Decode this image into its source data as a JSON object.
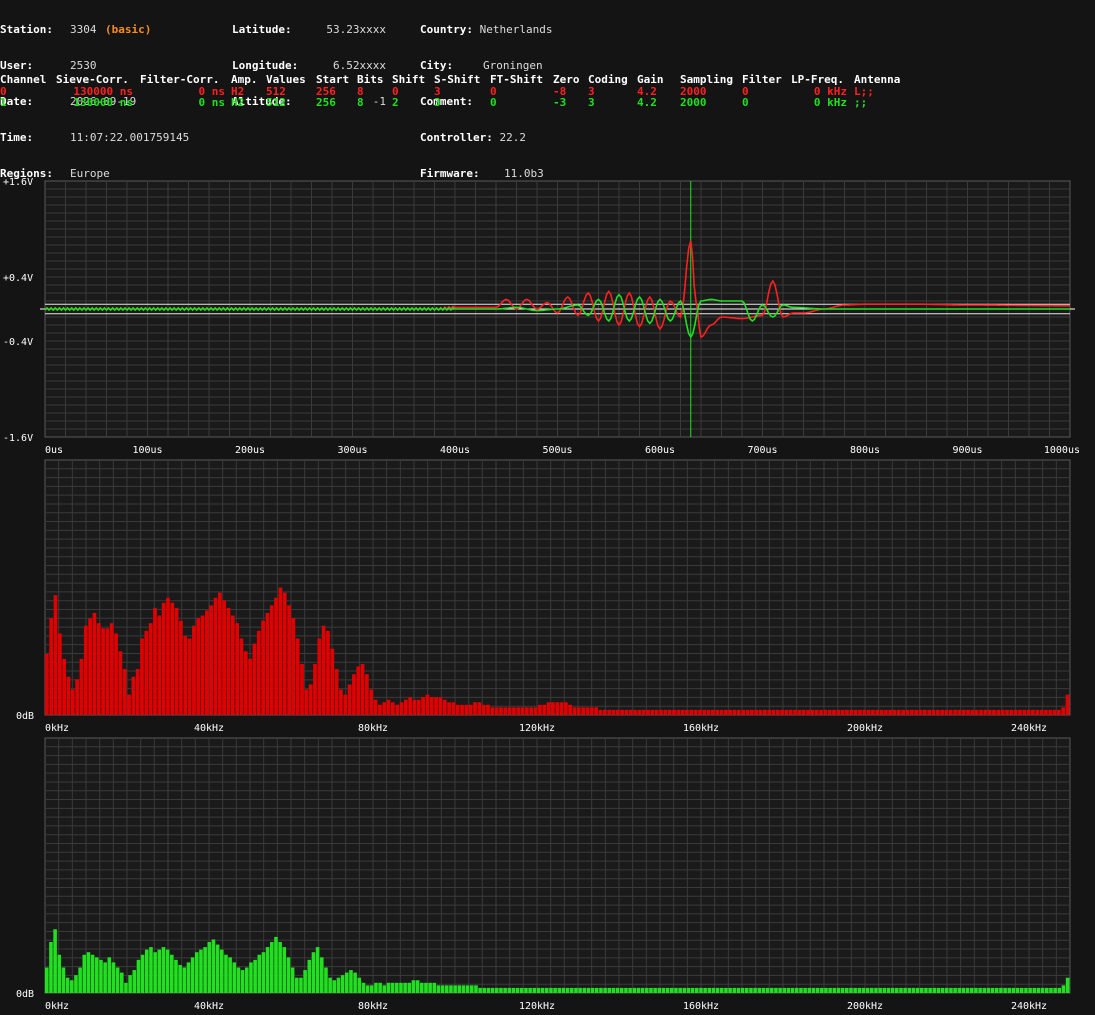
{
  "header": {
    "col1": [
      {
        "label": "Station:",
        "value": "3304",
        "extra": "(basic)"
      },
      {
        "label": "User:",
        "value": "2530"
      },
      {
        "label": "Date:",
        "value": "2026-09-19"
      },
      {
        "label": "Time:",
        "value": "11:07:22.001759145"
      },
      {
        "label": "Regions:",
        "value": "Europe"
      }
    ],
    "col2": [
      {
        "label": "Latitude:",
        "value": "53.23xxxx"
      },
      {
        "label": "Longitude:",
        "value": "6.52xxxx"
      },
      {
        "label": "Altitude:",
        "value": "-1"
      }
    ],
    "col3": [
      {
        "label": "Country:",
        "value": "Netherlands"
      },
      {
        "label": "City:",
        "value": "Groningen"
      },
      {
        "label": "Comment:",
        "value": ""
      },
      {
        "label": "Controller:",
        "value": "22.2"
      },
      {
        "label": "Firmware:",
        "value": "11.0b3"
      }
    ]
  },
  "channels": {
    "headers": [
      "Channel",
      "Sieve-Corr.",
      "Filter-Corr.",
      "Amp.",
      "Values",
      "Start",
      "Bits",
      "Shift",
      "S-Shift",
      "FT-Shift",
      "Zero",
      "Coding",
      "Gain",
      "Sampling",
      "Filter",
      "LP-Freq.",
      "Antenna"
    ],
    "rows": [
      {
        "color": "#ff2020",
        "cells": [
          "0",
          "130000 ns",
          "0 ns",
          "H2",
          "512",
          "256",
          "8",
          "0",
          "3",
          "0",
          "-8",
          "3",
          "4.2",
          "2000",
          "0",
          "0 kHz",
          "L;;"
        ]
      },
      {
        "color": "#20e020",
        "cells": [
          "1",
          "130000 ns",
          "0 ns",
          "H2",
          "512",
          "256",
          "8",
          "2",
          "3",
          "0",
          "-3",
          "3",
          "4.2",
          "2000",
          "0",
          "0 kHz",
          ";;"
        ]
      }
    ]
  },
  "chart_data": [
    {
      "type": "line",
      "xlabel": "",
      "ylabel": "",
      "x_ticks": [
        "0us",
        "100us",
        "200us",
        "300us",
        "400us",
        "500us",
        "600us",
        "700us",
        "800us",
        "900us",
        "1000us"
      ],
      "y_ticks": [
        "+1.6V",
        "+0.4V",
        "-0.4V",
        "-1.6V"
      ],
      "xlim": [
        0,
        1000
      ],
      "ylim": [
        -1.6,
        1.6
      ],
      "trigger_x": 630,
      "series": [
        {
          "color": "#ff2020",
          "points": [
            [
              0,
              0.0
            ],
            [
              380,
              0.0
            ],
            [
              400,
              0.02
            ],
            [
              440,
              0.02
            ],
            [
              450,
              0.12
            ],
            [
              460,
              0.0
            ],
            [
              470,
              0.12
            ],
            [
              480,
              0.0
            ],
            [
              490,
              0.08
            ],
            [
              500,
              -0.05
            ],
            [
              510,
              0.15
            ],
            [
              520,
              -0.08
            ],
            [
              530,
              0.2
            ],
            [
              540,
              -0.15
            ],
            [
              550,
              0.22
            ],
            [
              560,
              -0.2
            ],
            [
              570,
              0.2
            ],
            [
              580,
              -0.22
            ],
            [
              590,
              0.15
            ],
            [
              600,
              -0.25
            ],
            [
              610,
              0.1
            ],
            [
              620,
              -0.1
            ],
            [
              630,
              0.85
            ],
            [
              635,
              0.1
            ],
            [
              640,
              -0.35
            ],
            [
              650,
              -0.2
            ],
            [
              660,
              -0.1
            ],
            [
              680,
              -0.12
            ],
            [
              700,
              -0.08
            ],
            [
              710,
              0.35
            ],
            [
              720,
              -0.1
            ],
            [
              730,
              -0.05
            ],
            [
              740,
              -0.05
            ],
            [
              760,
              0.0
            ],
            [
              780,
              0.05
            ],
            [
              800,
              0.06
            ],
            [
              850,
              0.06
            ],
            [
              900,
              0.05
            ],
            [
              1000,
              0.04
            ]
          ]
        },
        {
          "color": "#20e020",
          "points": [
            [
              0,
              0.0
            ],
            [
              400,
              0.0
            ],
            [
              440,
              0.0
            ],
            [
              460,
              0.02
            ],
            [
              480,
              -0.02
            ],
            [
              500,
              0.0
            ],
            [
              520,
              0.05
            ],
            [
              530,
              -0.08
            ],
            [
              540,
              0.12
            ],
            [
              550,
              -0.15
            ],
            [
              560,
              0.18
            ],
            [
              570,
              -0.15
            ],
            [
              580,
              0.15
            ],
            [
              590,
              -0.18
            ],
            [
              600,
              0.12
            ],
            [
              610,
              -0.15
            ],
            [
              620,
              0.1
            ],
            [
              630,
              -0.35
            ],
            [
              640,
              0.1
            ],
            [
              650,
              0.12
            ],
            [
              660,
              0.1
            ],
            [
              680,
              0.1
            ],
            [
              690,
              -0.15
            ],
            [
              700,
              0.05
            ],
            [
              710,
              -0.1
            ],
            [
              720,
              0.05
            ],
            [
              730,
              0.02
            ],
            [
              760,
              0.0
            ],
            [
              1000,
              0.0
            ]
          ]
        }
      ]
    },
    {
      "type": "bar",
      "color": "#e00000",
      "x_ticks": [
        "0kHz",
        "40kHz",
        "80kHz",
        "120kHz",
        "160kHz",
        "200kHz",
        "240kHz"
      ],
      "y_ticks": [
        "0dB"
      ],
      "values": [
        0.24,
        0.38,
        0.47,
        0.32,
        0.22,
        0.15,
        0.1,
        0.14,
        0.22,
        0.35,
        0.38,
        0.4,
        0.36,
        0.34,
        0.34,
        0.36,
        0.32,
        0.25,
        0.18,
        0.08,
        0.15,
        0.18,
        0.3,
        0.33,
        0.36,
        0.42,
        0.39,
        0.44,
        0.46,
        0.44,
        0.42,
        0.37,
        0.31,
        0.3,
        0.35,
        0.38,
        0.39,
        0.41,
        0.43,
        0.46,
        0.48,
        0.45,
        0.42,
        0.39,
        0.36,
        0.3,
        0.25,
        0.22,
        0.28,
        0.33,
        0.37,
        0.4,
        0.43,
        0.46,
        0.5,
        0.48,
        0.43,
        0.38,
        0.3,
        0.2,
        0.1,
        0.12,
        0.2,
        0.3,
        0.35,
        0.33,
        0.26,
        0.18,
        0.1,
        0.08,
        0.12,
        0.16,
        0.19,
        0.2,
        0.16,
        0.1,
        0.06,
        0.04,
        0.05,
        0.06,
        0.05,
        0.04,
        0.05,
        0.06,
        0.07,
        0.06,
        0.06,
        0.07,
        0.08,
        0.07,
        0.07,
        0.07,
        0.06,
        0.05,
        0.05,
        0.04,
        0.04,
        0.04,
        0.04,
        0.05,
        0.05,
        0.04,
        0.04,
        0.03,
        0.03,
        0.03,
        0.03,
        0.03,
        0.03,
        0.03,
        0.03,
        0.03,
        0.03,
        0.03,
        0.04,
        0.04,
        0.05,
        0.05,
        0.05,
        0.05,
        0.05,
        0.04,
        0.03,
        0.03,
        0.03,
        0.03,
        0.03,
        0.03,
        0.02,
        0.02,
        0.02,
        0.02,
        0.02,
        0.02,
        0.02,
        0.02,
        0.02,
        0.02,
        0.02,
        0.02,
        0.02,
        0.02,
        0.02,
        0.02,
        0.02,
        0.02,
        0.02,
        0.02,
        0.02,
        0.02,
        0.02,
        0.02,
        0.02,
        0.02,
        0.02,
        0.02,
        0.02,
        0.02,
        0.02,
        0.02,
        0.02,
        0.02,
        0.02,
        0.02,
        0.02,
        0.02,
        0.02,
        0.02,
        0.02,
        0.02,
        0.02,
        0.02,
        0.02,
        0.02,
        0.02,
        0.02,
        0.02,
        0.02,
        0.02,
        0.02,
        0.02,
        0.02,
        0.02,
        0.02,
        0.02,
        0.02,
        0.02,
        0.02,
        0.02,
        0.02,
        0.02,
        0.02,
        0.02,
        0.02,
        0.02,
        0.02,
        0.02,
        0.02,
        0.02,
        0.02,
        0.02,
        0.02,
        0.02,
        0.02,
        0.02,
        0.02,
        0.02,
        0.02,
        0.02,
        0.02,
        0.02,
        0.02,
        0.02,
        0.02,
        0.02,
        0.02,
        0.02,
        0.02,
        0.02,
        0.02,
        0.02,
        0.02,
        0.02,
        0.02,
        0.02,
        0.02,
        0.02,
        0.02,
        0.02,
        0.02,
        0.02,
        0.02,
        0.02,
        0.02,
        0.02,
        0.03,
        0.08
      ]
    },
    {
      "type": "bar",
      "color": "#20e020",
      "x_ticks": [
        "0kHz",
        "40kHz",
        "80kHz",
        "120kHz",
        "160kHz",
        "200kHz",
        "240kHz"
      ],
      "y_ticks": [
        "0dB"
      ],
      "values": [
        0.1,
        0.2,
        0.25,
        0.15,
        0.1,
        0.06,
        0.05,
        0.07,
        0.1,
        0.15,
        0.16,
        0.15,
        0.14,
        0.13,
        0.12,
        0.14,
        0.12,
        0.1,
        0.08,
        0.04,
        0.07,
        0.09,
        0.13,
        0.15,
        0.17,
        0.18,
        0.16,
        0.17,
        0.18,
        0.17,
        0.15,
        0.13,
        0.11,
        0.1,
        0.12,
        0.14,
        0.16,
        0.17,
        0.18,
        0.2,
        0.21,
        0.19,
        0.17,
        0.15,
        0.14,
        0.12,
        0.1,
        0.09,
        0.1,
        0.12,
        0.13,
        0.15,
        0.16,
        0.18,
        0.2,
        0.22,
        0.2,
        0.18,
        0.14,
        0.1,
        0.06,
        0.06,
        0.09,
        0.13,
        0.16,
        0.18,
        0.14,
        0.1,
        0.06,
        0.05,
        0.06,
        0.07,
        0.08,
        0.09,
        0.08,
        0.06,
        0.04,
        0.03,
        0.03,
        0.04,
        0.04,
        0.03,
        0.04,
        0.04,
        0.04,
        0.04,
        0.04,
        0.04,
        0.05,
        0.05,
        0.04,
        0.04,
        0.04,
        0.04,
        0.03,
        0.03,
        0.03,
        0.03,
        0.03,
        0.03,
        0.03,
        0.03,
        0.03,
        0.03,
        0.02,
        0.02,
        0.02,
        0.02,
        0.02,
        0.02,
        0.02,
        0.02,
        0.02,
        0.02,
        0.02,
        0.02,
        0.02,
        0.02,
        0.02,
        0.02,
        0.02,
        0.02,
        0.02,
        0.02,
        0.02,
        0.02,
        0.02,
        0.02,
        0.02,
        0.02,
        0.02,
        0.02,
        0.02,
        0.02,
        0.02,
        0.02,
        0.02,
        0.02,
        0.02,
        0.02,
        0.02,
        0.02,
        0.02,
        0.02,
        0.02,
        0.02,
        0.02,
        0.02,
        0.02,
        0.02,
        0.02,
        0.02,
        0.02,
        0.02,
        0.02,
        0.02,
        0.02,
        0.02,
        0.02,
        0.02,
        0.02,
        0.02,
        0.02,
        0.02,
        0.02,
        0.02,
        0.02,
        0.02,
        0.02,
        0.02,
        0.02,
        0.02,
        0.02,
        0.02,
        0.02,
        0.02,
        0.02,
        0.02,
        0.02,
        0.02,
        0.02,
        0.02,
        0.02,
        0.02,
        0.02,
        0.02,
        0.02,
        0.02,
        0.02,
        0.02,
        0.02,
        0.02,
        0.02,
        0.02,
        0.02,
        0.02,
        0.02,
        0.02,
        0.02,
        0.02,
        0.02,
        0.02,
        0.02,
        0.02,
        0.02,
        0.02,
        0.02,
        0.02,
        0.02,
        0.02,
        0.02,
        0.02,
        0.02,
        0.02,
        0.02,
        0.02,
        0.02,
        0.02,
        0.02,
        0.02,
        0.02,
        0.02,
        0.02,
        0.02,
        0.02,
        0.02,
        0.02,
        0.02,
        0.02,
        0.02,
        0.02,
        0.02,
        0.02,
        0.02,
        0.02,
        0.02,
        0.02,
        0.02,
        0.02,
        0.02,
        0.02,
        0.02,
        0.02,
        0.02,
        0.03,
        0.06
      ]
    }
  ]
}
